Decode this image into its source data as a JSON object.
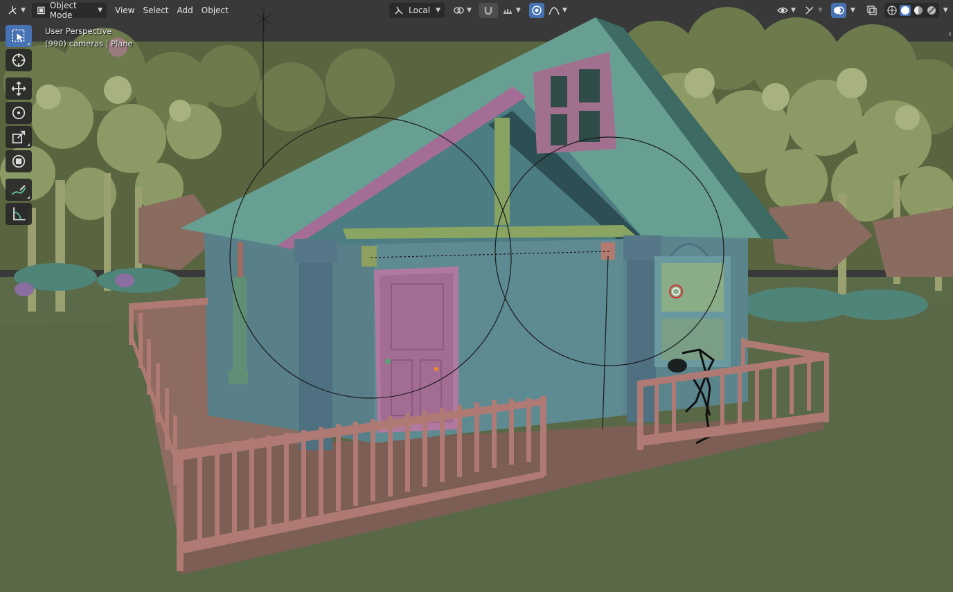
{
  "header": {
    "editor_type_icon": "view3d-editor-icon",
    "mode": "Object Mode",
    "menus": [
      "View",
      "Select",
      "Add",
      "Object"
    ],
    "transform_orientation": "Local",
    "pivot_icon": "pivot-icon",
    "snap_icon": "magnet-icon",
    "snap_target_icon": "snap-increment-icon",
    "proportional_icon": "proportional-edit-icon",
    "falloff_icon": "falloff-curve-icon",
    "visibility_icon": "eye-icon",
    "gizmo_icon": "gizmo-icon",
    "overlay_icon": "overlay-icon",
    "xray_icon": "xray-icon",
    "shading_modes": [
      "wireframe",
      "solid",
      "material-preview",
      "rendered"
    ],
    "active_shading": "solid"
  },
  "toolbar": {
    "tools": [
      "select-box",
      "cursor",
      "move",
      "rotate",
      "scale",
      "transform",
      "annotate",
      "measure"
    ],
    "active_tool": "select-box"
  },
  "viewport": {
    "view_name": "User Perspective",
    "info": "(990) cameras | Plane"
  },
  "colors": {
    "accent": "#4772b3",
    "sky": "#393939",
    "ground": "#5a6a48",
    "house_wall": "#5d8a90",
    "roof": "#5f9a8c",
    "door": "#9a6888",
    "fence": "#a56e6a",
    "foliage": "#7e8c5c"
  }
}
